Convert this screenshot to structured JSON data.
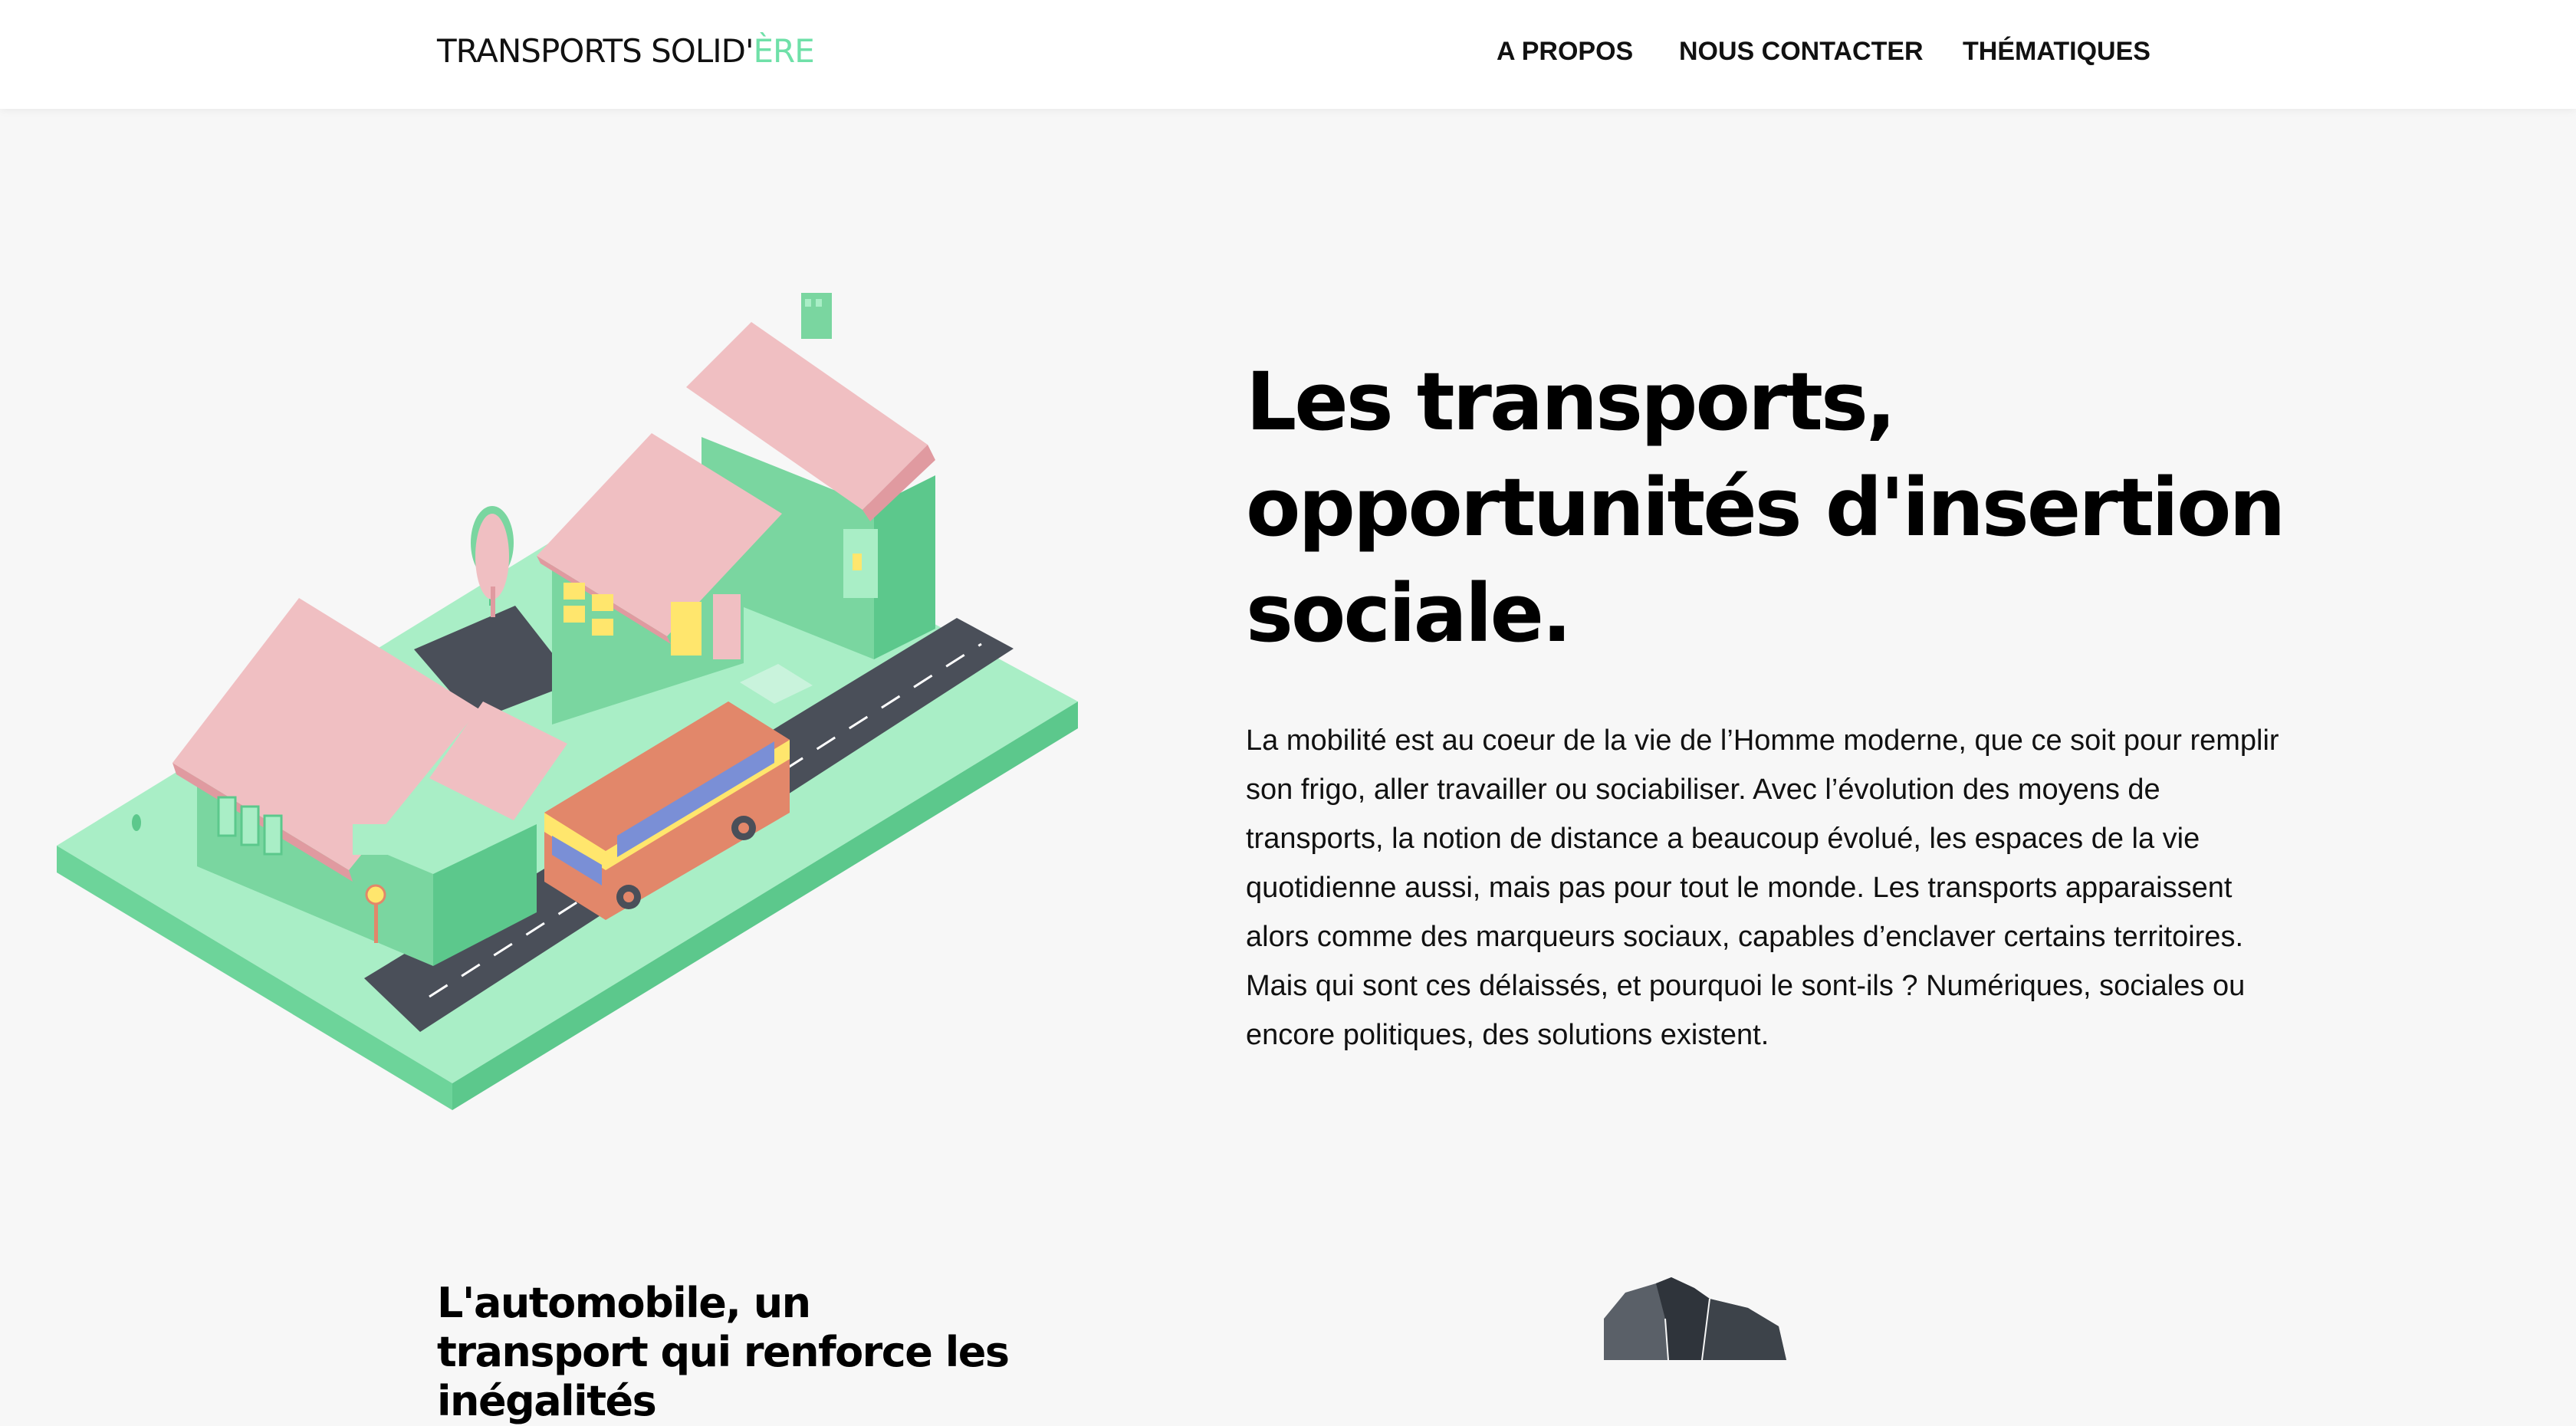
{
  "header": {
    "logo_main": "TRANSPORTS SOLID'",
    "logo_accent": "ÈRE",
    "nav": [
      {
        "label": "A PROPOS"
      },
      {
        "label": "NOUS CONTACTER"
      },
      {
        "label": "THÉMATIQUES"
      }
    ]
  },
  "hero": {
    "title": "Les transports, opportunités d'insertion sociale.",
    "intro": "La mobilité est au coeur de la vie de l’Homme moderne, que ce soit pour remplir son frigo, aller travailler ou sociabiliser. Avec l’évolution des moyens de transports, la notion de distance a beaucoup évolué, les espaces de la vie quotidienne aussi, mais pas pour tout le monde. Les transports apparaissent alors comme des marqueurs sociaux, capables d’enclaver certains territoires. Mais qui sont ces délaissés, et pourquoi le sont-ils ? Numériques, sociales ou encore politiques, des solutions existent.",
    "illustration_icon": "isometric-town-bus-illustration"
  },
  "section2": {
    "title": "L'automobile, un transport qui renforce les inégalités",
    "map_icon": "region-map-illustration"
  },
  "colors": {
    "accent": "#6fe0a8",
    "background": "#f7f7f7",
    "roof": "#f0bfc2",
    "wall": "#7ad6a0",
    "ground": "#a9eec6",
    "road": "#4a4f59",
    "bus": "#e2876a"
  }
}
